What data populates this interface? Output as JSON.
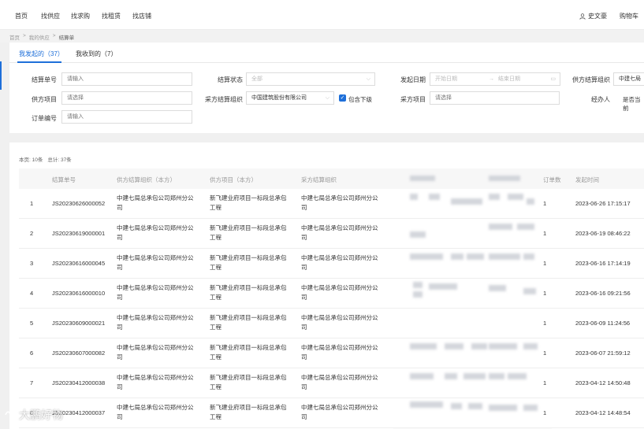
{
  "nav": {
    "items": [
      "首页",
      "找供应",
      "找求购",
      "找租赁",
      "找店铺"
    ],
    "user": "史文豪",
    "cart": "购物车"
  },
  "breadcrumb": [
    "首页",
    ">",
    "我的供应",
    ">",
    "结算单"
  ],
  "tabs": [
    {
      "label": "我发起的（37）",
      "active": true
    },
    {
      "label": "我收到的（7）",
      "active": false
    }
  ],
  "filters": {
    "settlement_no": {
      "label": "结算单号",
      "placeholder": "请输入"
    },
    "settlement_status": {
      "label": "结算状态",
      "placeholder": "全部"
    },
    "start_date": {
      "label": "发起日期",
      "from_placeholder": "开始日期",
      "arrow": "→",
      "to_placeholder": "结束日期"
    },
    "supplier_org": {
      "label": "供方结算组织",
      "value": "中建七局"
    },
    "supplier_project": {
      "label": "供方项目",
      "placeholder": "请选择"
    },
    "buyer_org": {
      "label": "采方结算组织",
      "value": "中国建筑股份有限公司",
      "include_sub_label": "包含下级",
      "include_sub_checked": true
    },
    "buyer_project": {
      "label": "采方项目",
      "placeholder": "请选择"
    },
    "handler": {
      "label": "经办人",
      "option_label": "是否当前"
    },
    "order_no": {
      "label": "订单编号",
      "placeholder": "请输入"
    }
  },
  "summary": {
    "page_size": "本页: 10条",
    "total": "总计: 37条"
  },
  "table": {
    "headers": [
      "结算单号",
      "供方结算组织（本方）",
      "供方项目（本方）",
      "采方结算组织",
      "订单数",
      "发起时间"
    ],
    "rows": [
      {
        "idx": "1",
        "no": "JS20230626000052",
        "supplier_org": "中建七局总承包公司郑州分公司",
        "supplier_project": "新飞建业府项目一标段总承包工程",
        "buyer_org": "中建七局总承包公司郑州分公司",
        "orders": "1",
        "time": "2023-06-26 17:15:17"
      },
      {
        "idx": "2",
        "no": "JS20230619000001",
        "supplier_org": "中建七局总承包公司郑州分公司",
        "supplier_project": "新飞建业府项目一标段总承包工程",
        "buyer_org": "中建七局总承包公司郑州分公司",
        "orders": "1",
        "time": "2023-06-19 08:46:22"
      },
      {
        "idx": "3",
        "no": "JS20230616000045",
        "supplier_org": "中建七局总承包公司郑州分公司",
        "supplier_project": "新飞建业府项目一标段总承包工程",
        "buyer_org": "中建七局总承包公司郑州分公司",
        "orders": "1",
        "time": "2023-06-16 17:14:19"
      },
      {
        "idx": "4",
        "no": "JS20230616000010",
        "supplier_org": "中建七局总承包公司郑州分公司",
        "supplier_project": "新飞建业府项目一标段总承包工程",
        "buyer_org": "中建七局总承包公司郑州分公司",
        "orders": "1",
        "time": "2023-06-16 09:21:56"
      },
      {
        "idx": "5",
        "no": "JS20230609000021",
        "supplier_org": "中建七局总承包公司郑州分公司",
        "supplier_project": "新飞建业府项目一标段总承包工程",
        "buyer_org": "中建七局总承包公司郑州分公司",
        "orders": "1",
        "time": "2023-06-09 11:24:56"
      },
      {
        "idx": "6",
        "no": "JS20230607000082",
        "supplier_org": "中建七局总承包公司郑州分公司",
        "supplier_project": "新飞建业府项目一标段总承包工程",
        "buyer_org": "中建七局总承包公司郑州分公司",
        "orders": "1",
        "time": "2023-06-07 21:59:12"
      },
      {
        "idx": "7",
        "no": "JS20230412000038",
        "supplier_org": "中建七局总承包公司郑州分公司",
        "supplier_project": "新飞建业府项目一标段总承包工程",
        "buyer_org": "中建七局总承包公司郑州分公司",
        "orders": "1",
        "time": "2023-04-12 14:50:48"
      },
      {
        "idx": "8",
        "no": "JS20230412000037",
        "supplier_org": "中建七局总承包公司郑州分公司",
        "supplier_project": "新飞建业府项目一标段总承包工程",
        "buyer_org": "中建七局总承包公司郑州分公司",
        "orders": "1",
        "time": "2023-04-12 14:48:54"
      }
    ]
  },
  "watermark": "大鹏好物",
  "colors": {
    "accent": "#1e6fd9"
  }
}
